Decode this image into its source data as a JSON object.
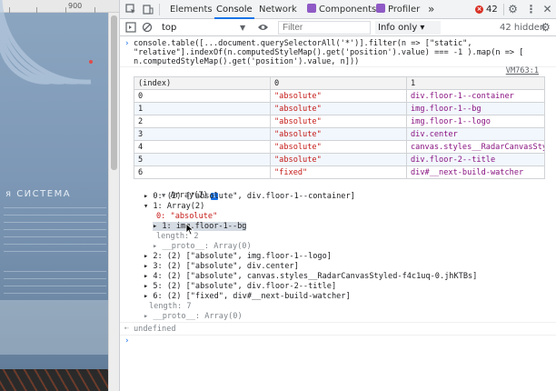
{
  "preview": {
    "ruler_label": "900",
    "heading": "я СИСТЕМА"
  },
  "devtools": {
    "tabs": [
      {
        "label": "Elements",
        "active": false
      },
      {
        "label": "Console",
        "active": true
      },
      {
        "label": "Network",
        "active": false
      },
      {
        "label": "Components",
        "active": false
      },
      {
        "label": "Profiler",
        "active": false
      }
    ],
    "more_tabs": "»",
    "errors": "42",
    "toolbar": {
      "context": "top",
      "filter_placeholder": "Filter",
      "levels": "Info only ▾",
      "hidden": "42 hidden"
    }
  },
  "console": {
    "command_line1": "console.table([...document.querySelectorAll('*')].filter(n => [\"static\",",
    "command_line2": "\"relative\"].indexOf(n.computedStyleMap().get('position').value) === -1 ).map(n => [",
    "command_line3": "n.computedStyleMap().get('position').value, n]))",
    "source_link": "VM763:1",
    "table": {
      "headers": [
        "(index)",
        "0",
        "1"
      ],
      "rows": [
        [
          "0",
          "\"absolute\"",
          "div.floor-1--container"
        ],
        [
          "1",
          "\"absolute\"",
          "img.floor-1--bg"
        ],
        [
          "2",
          "\"absolute\"",
          "img.floor-1--logo"
        ],
        [
          "3",
          "\"absolute\"",
          "div.center"
        ],
        [
          "4",
          "\"absolute\"",
          "canvas.styles__RadarCanvasStyled-f4c1uq-0.jhKTBs"
        ],
        [
          "5",
          "\"absolute\"",
          "div.floor-2--title"
        ],
        [
          "6",
          "\"fixed\"",
          "div#__next-build-watcher"
        ]
      ]
    },
    "tree": {
      "root": "Array(7)",
      "items": [
        "▸ 0: (2) [\"absolute\", div.floor-1--container]",
        "▾ 1: Array(2)",
        "0: \"absolute\"",
        "▸ 1: img.floor-1--bg",
        "length: 2",
        "▸ __proto__: Array(0)",
        "▸ 2: (2) [\"absolute\", img.floor-1--logo]",
        "▸ 3: (2) [\"absolute\", div.center]",
        "▸ 4: (2) [\"absolute\", canvas.styles__RadarCanvasStyled-f4c1uq-0.jhKTBs]",
        "▸ 5: (2) [\"absolute\", div.floor-2--title]",
        "▸ 6: (2) [\"fixed\", div#__next-build-watcher]",
        "length: 7",
        "▸ __proto__: Array(0)"
      ]
    },
    "result": "undefined"
  }
}
